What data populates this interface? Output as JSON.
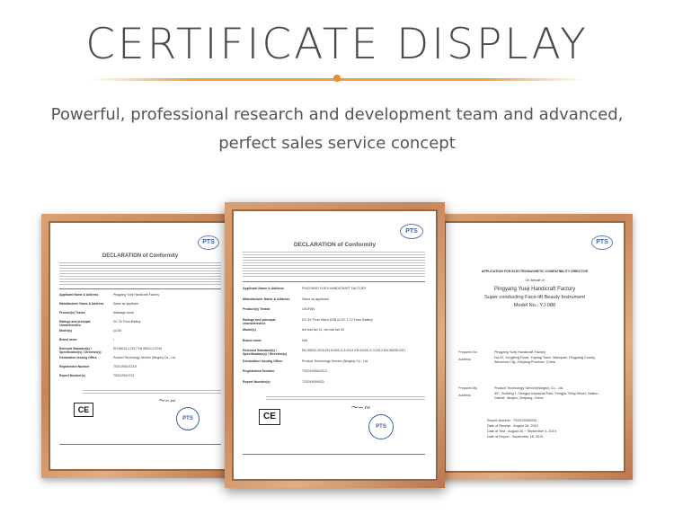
{
  "header": {
    "title": "CERTIFICATE DISPLAY",
    "subtitle": "Powerful, professional research and development team and advanced, perfect sales service concept"
  },
  "colors": {
    "accent": "#f0a040",
    "frame": "#c8865a",
    "seal": "#3f5fa6"
  },
  "certificates": {
    "left": {
      "logo": "PTS",
      "heading": "DECLARATION of Conformity",
      "rows": [
        {
          "label": "Applicant Name & Address",
          "value": "Pingyang Yueji Handicraft Factory"
        },
        {
          "label": "Manufacturer Name & Address",
          "value": "Same as applicant"
        },
        {
          "label": "Product(s) Tested",
          "value": "Massage comb"
        },
        {
          "label": "Ratings and principal characteristics",
          "value": "DC 3V From Battery"
        },
        {
          "label": "Model(s)",
          "value": "yj-016"
        },
        {
          "label": "Brand name",
          "value": "/"
        },
        {
          "label": "Relevant Standard(s) / Specification(s) / Directive(s)",
          "value": "EN 55014-1:2017  EN 55014-2:2015"
        },
        {
          "label": "Declaration Issuing Office",
          "value": "Product Technology Service (Ningbo) Co., Ltd."
        },
        {
          "label": "Registration Number",
          "value": "TS2019010723-9"
        },
        {
          "label": "Report Number(s)",
          "value": "TS2019010723"
        }
      ],
      "ce": "CE",
      "seal": "PTS"
    },
    "center": {
      "logo": "PTS",
      "heading": "DECLARATION of Conformity",
      "rows": [
        {
          "label": "Applicant Name & Address",
          "value": "PINGYANG YUEJI HANDICRAFT FACTORY"
        },
        {
          "label": "Manufacturer Name & Address",
          "value": "Same as applicant"
        },
        {
          "label": "Product(s) Tested",
          "value": "LEDFAN"
        },
        {
          "label": "Ratings and principal characteristics",
          "value": "DC 5V From Micro USB or DC 3.7V From Battery"
        },
        {
          "label": "Model(s)",
          "value": "led fold fan 01, led fold fan 02"
        },
        {
          "label": "Brand name",
          "value": "N/A"
        },
        {
          "label": "Relevant Standard(s) / Specification(s) / Directive(s)",
          "value": "EN 55032:2015  EN 61000-3-2:2014  EN 61000-3-3:2013  EN 55035:2017"
        },
        {
          "label": "Declaration Issuing Office",
          "value": "Product Technology Service (Ningbo) Co., Ltd."
        },
        {
          "label": "Registration Number",
          "value": "TS2019090433-C"
        },
        {
          "label": "Report Number(s)",
          "value": "TS2019090433"
        }
      ],
      "ce": "CE",
      "seal": "PTS"
    },
    "right": {
      "logo": "PTS",
      "heading": "APPLICATION FOR ELECTROMAGNETIC COMPATIBILITY DIRECTIVE",
      "behalf": "On Behalf of",
      "company": "Pingyang Yueji Handicraft Factory",
      "product": "Super conducting Face-lift Beauty Instrument",
      "model": "Model No.: YJ-088",
      "prepared_for_label": "Prepared for",
      "prepared_for": "Pingyang Yueji Handicraft Factory",
      "prepared_for_addr": "No.20, Yongfeng Road, Yuyang Town, Wanquan, Pingyang County, Wenzhou City, Zhejiang Province, China",
      "prepared_by_label": "Prepared By",
      "prepared_by": "Product Technology Service(Ningbo) Co., Ltd.",
      "prepared_by_addr": "3/F., Building 1, Hengyu Industrial Park, Fengjia, Shiqi Street, Haishu District, Ningbo, Zhejiang, China",
      "address_label": "Address",
      "report_no": "Report Number    :  TS2019082933",
      "receipt": "Date of Receipt   :  August 26, 2019",
      "test": "Date of Test       :  August 26 ~ September 3, 2019",
      "report": "Date of Report    :  September 18, 2019"
    }
  }
}
